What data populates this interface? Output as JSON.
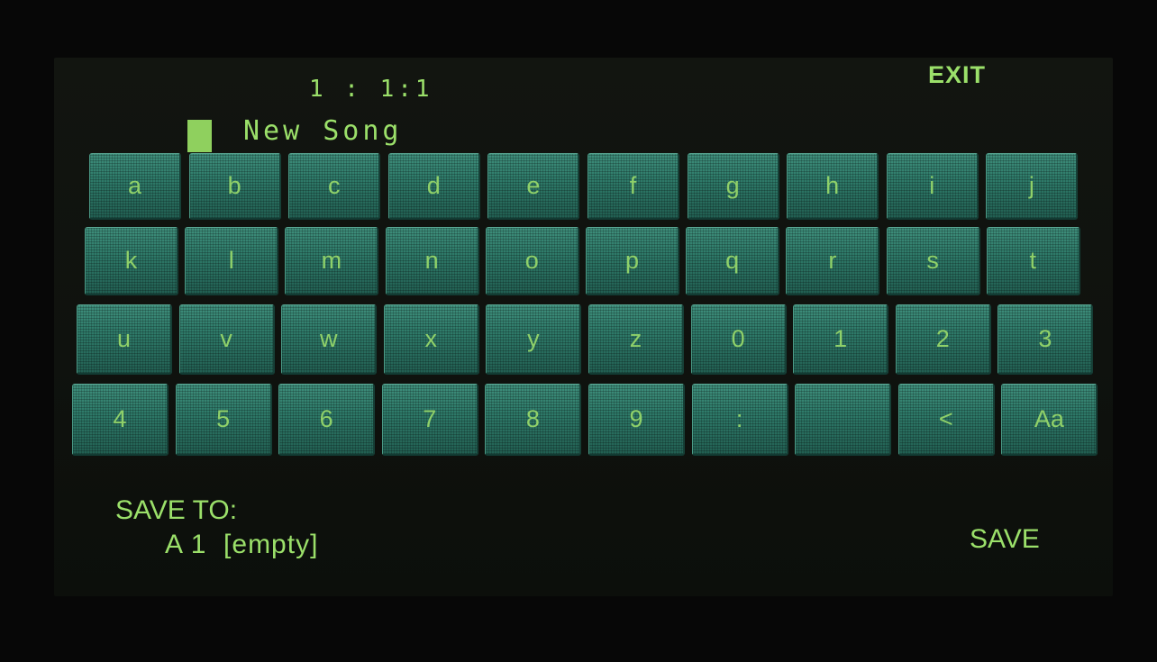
{
  "header": {
    "position_readout": "1 : 1:1",
    "exit_label": "EXIT"
  },
  "name_field": {
    "value": "New Song"
  },
  "keyboard": {
    "rows": [
      [
        "a",
        "b",
        "c",
        "d",
        "e",
        "f",
        "g",
        "h",
        "i",
        "j"
      ],
      [
        "k",
        "l",
        "m",
        "n",
        "o",
        "p",
        "q",
        "r",
        "s",
        "t"
      ],
      [
        "u",
        "v",
        "w",
        "x",
        "y",
        "z",
        "0",
        "1",
        "2",
        "3"
      ],
      [
        "4",
        "5",
        "6",
        "7",
        "8",
        "9",
        ":",
        "",
        "<",
        "Aa"
      ]
    ],
    "key_names": [
      [
        "key-a",
        "key-b",
        "key-c",
        "key-d",
        "key-e",
        "key-f",
        "key-g",
        "key-h",
        "key-i",
        "key-j"
      ],
      [
        "key-k",
        "key-l",
        "key-m",
        "key-n",
        "key-o",
        "key-p",
        "key-q",
        "key-r",
        "key-s",
        "key-t"
      ],
      [
        "key-u",
        "key-v",
        "key-w",
        "key-x",
        "key-y",
        "key-z",
        "key-0",
        "key-1",
        "key-2",
        "key-3"
      ],
      [
        "key-4",
        "key-5",
        "key-6",
        "key-7",
        "key-8",
        "key-9",
        "key-colon",
        "key-space",
        "key-backspace",
        "key-shift-case"
      ]
    ]
  },
  "footer": {
    "save_to_label": "SAVE TO:",
    "save_to_value": "A 1  [empty]",
    "save_label": "SAVE"
  },
  "colors": {
    "display_text": "#9be06a",
    "key_face": "#2e7a69",
    "screen_bg": "#0f120e"
  }
}
